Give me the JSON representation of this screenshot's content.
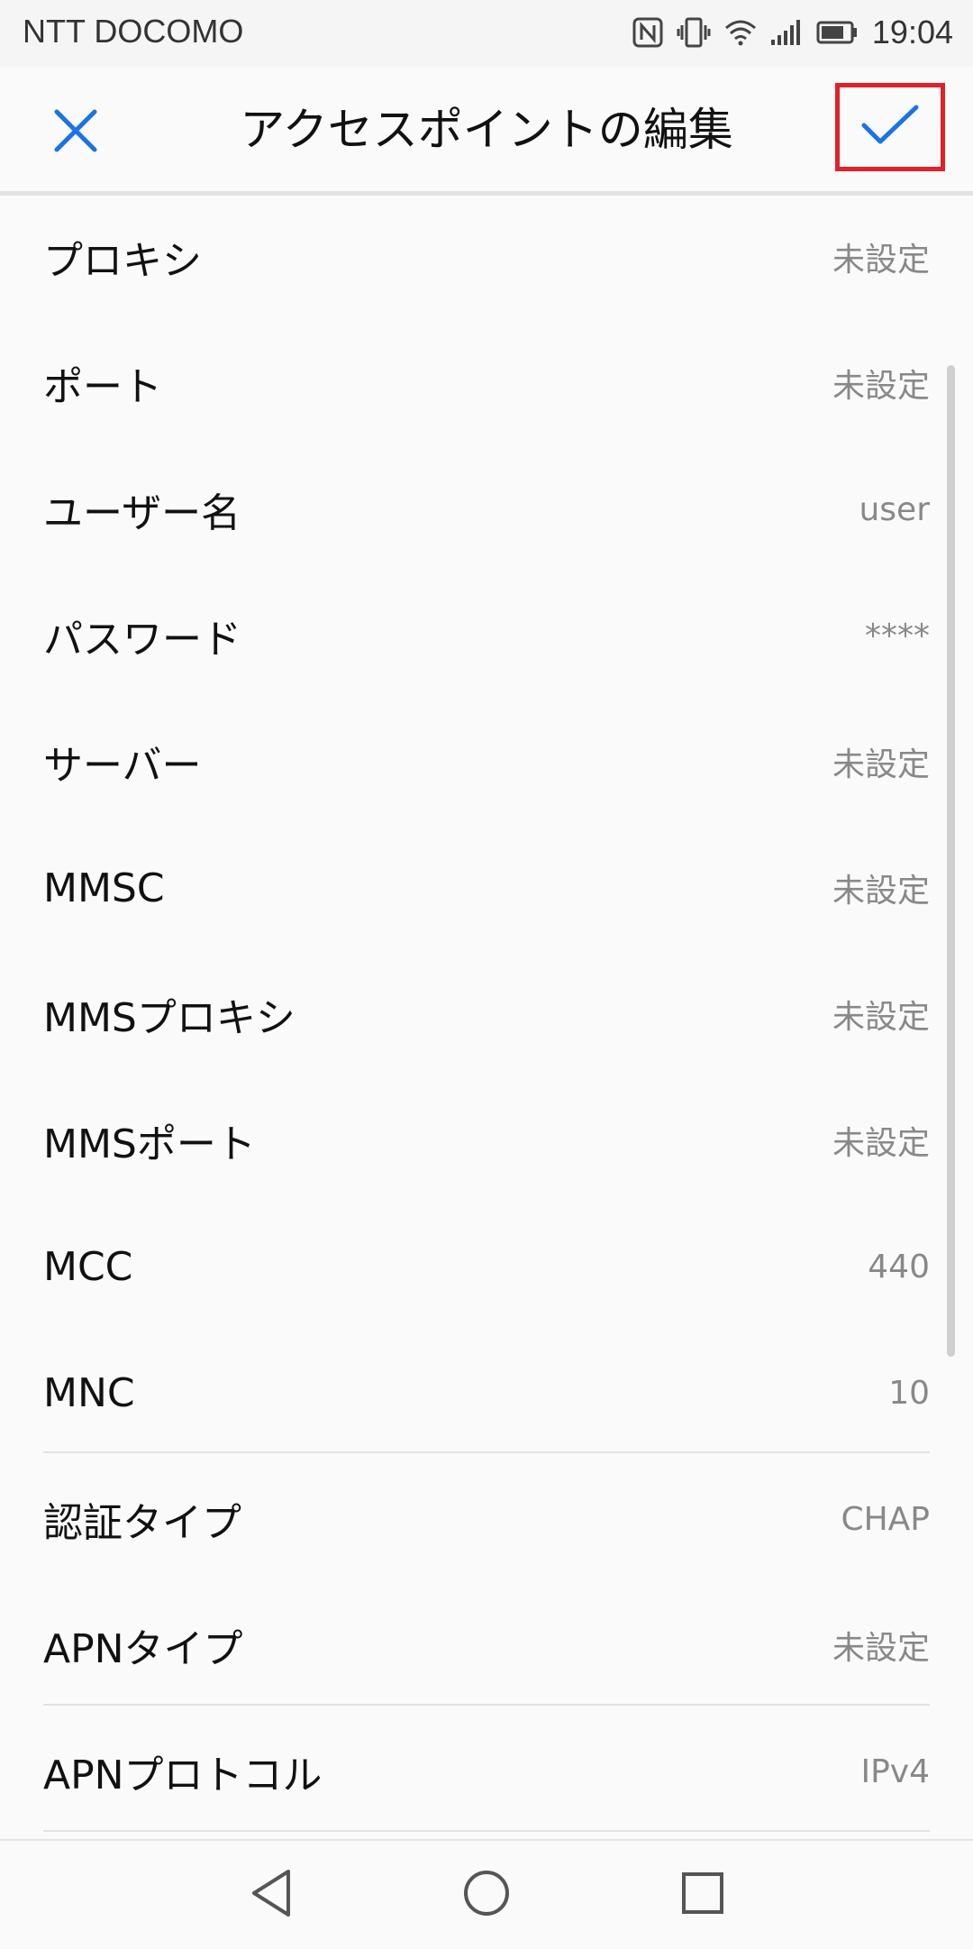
{
  "status_bar": {
    "carrier": "NTT DOCOMO",
    "time": "19:04",
    "icons": [
      "nfc-icon",
      "vibrate-icon",
      "wifi-icon",
      "signal-icon",
      "battery-icon"
    ]
  },
  "app_bar": {
    "title": "アクセスポイントの編集",
    "close_icon": "close-icon",
    "confirm_icon": "check-icon",
    "accent_color": "#1a73e8"
  },
  "settings": [
    {
      "label": "プロキシ",
      "value": "未設定"
    },
    {
      "label": "ポート",
      "value": "未設定"
    },
    {
      "label": "ユーザー名",
      "value": "user"
    },
    {
      "label": "パスワード",
      "value": "****"
    },
    {
      "label": "サーバー",
      "value": "未設定"
    },
    {
      "label": "MMSC",
      "value": "未設定"
    },
    {
      "label": "MMSプロキシ",
      "value": "未設定"
    },
    {
      "label": "MMSポート",
      "value": "未設定"
    },
    {
      "label": "MCC",
      "value": "440"
    },
    {
      "label": "MNC",
      "value": "10"
    },
    {
      "label": "認証タイプ",
      "value": "CHAP"
    },
    {
      "label": "APNタイプ",
      "value": "未設定"
    },
    {
      "label": "APNプロトコル",
      "value": "IPv4"
    }
  ],
  "nav_bar": {
    "icons": [
      "back-icon",
      "home-icon",
      "recents-icon"
    ]
  }
}
